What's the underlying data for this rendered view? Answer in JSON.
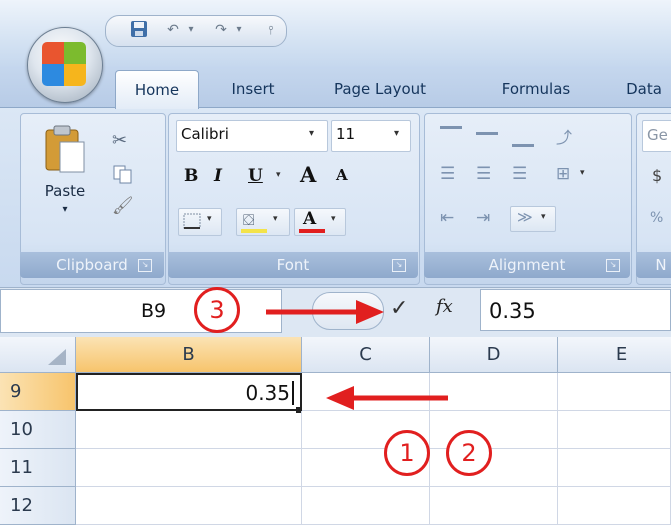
{
  "app": {
    "tabs": [
      {
        "label": "Home"
      },
      {
        "label": "Insert"
      },
      {
        "label": "Page Layout"
      },
      {
        "label": "Formulas"
      },
      {
        "label": "Data"
      }
    ]
  },
  "ribbon": {
    "clipboard": {
      "label": "Clipboard",
      "paste_label": "Paste"
    },
    "font": {
      "label": "Font",
      "font_name": "Calibri",
      "font_size": "11",
      "bold": "B",
      "italic": "I",
      "underline": "U",
      "grow": "A",
      "shrink": "A",
      "font_color": "A"
    },
    "alignment": {
      "label": "Alignment"
    },
    "number": {
      "label": "N",
      "format_partial": "Ge",
      "currency": "$"
    }
  },
  "formula_bar": {
    "name_box": "B9",
    "value": "0.35",
    "fx": "fx"
  },
  "sheet": {
    "columns": [
      "B",
      "C",
      "D",
      "E"
    ],
    "rows": [
      "9",
      "10",
      "11",
      "12"
    ],
    "active_cell_value": "0.35"
  },
  "callouts": [
    "1",
    "2",
    "3"
  ],
  "colors": {
    "arrow": "#e11f1f",
    "selected_header": "#f9c97c"
  }
}
